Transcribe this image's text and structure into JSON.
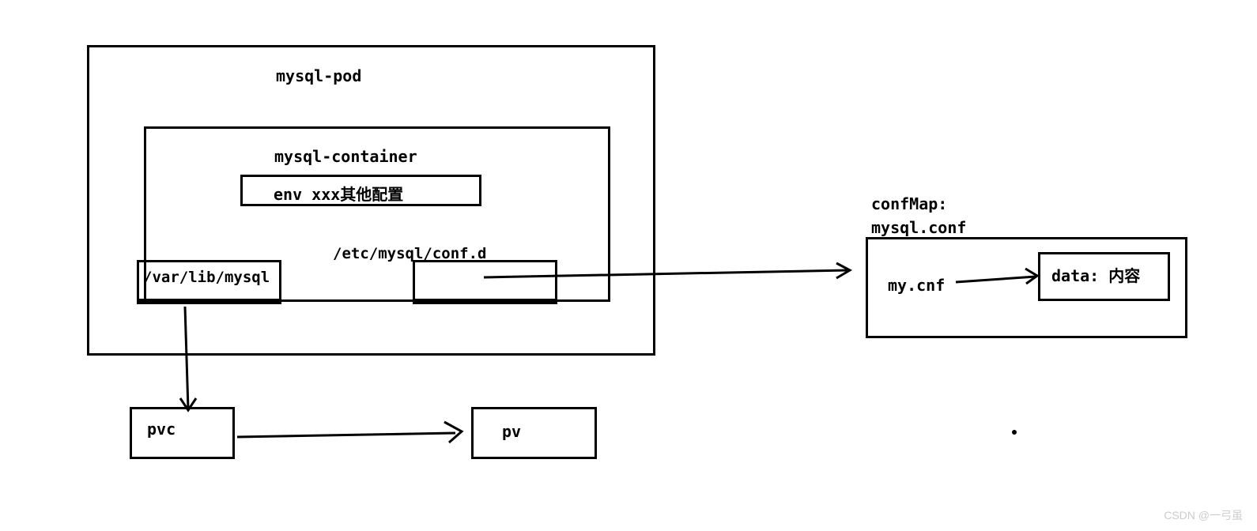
{
  "pod": {
    "label": "mysql-pod"
  },
  "container": {
    "label": "mysql-container"
  },
  "env": {
    "label": "env xxx其他配置"
  },
  "volume1": {
    "label": "/var/lib/mysql"
  },
  "volume2": {
    "label": "/etc/mysql/conf.d"
  },
  "pvc": {
    "label": "pvc"
  },
  "pv": {
    "label": "pv"
  },
  "configmap": {
    "header1": "confMap:",
    "header2": "mysql.conf",
    "file": "my.cnf",
    "data": "data: 内容"
  },
  "watermark": "CSDN @一弓虽"
}
